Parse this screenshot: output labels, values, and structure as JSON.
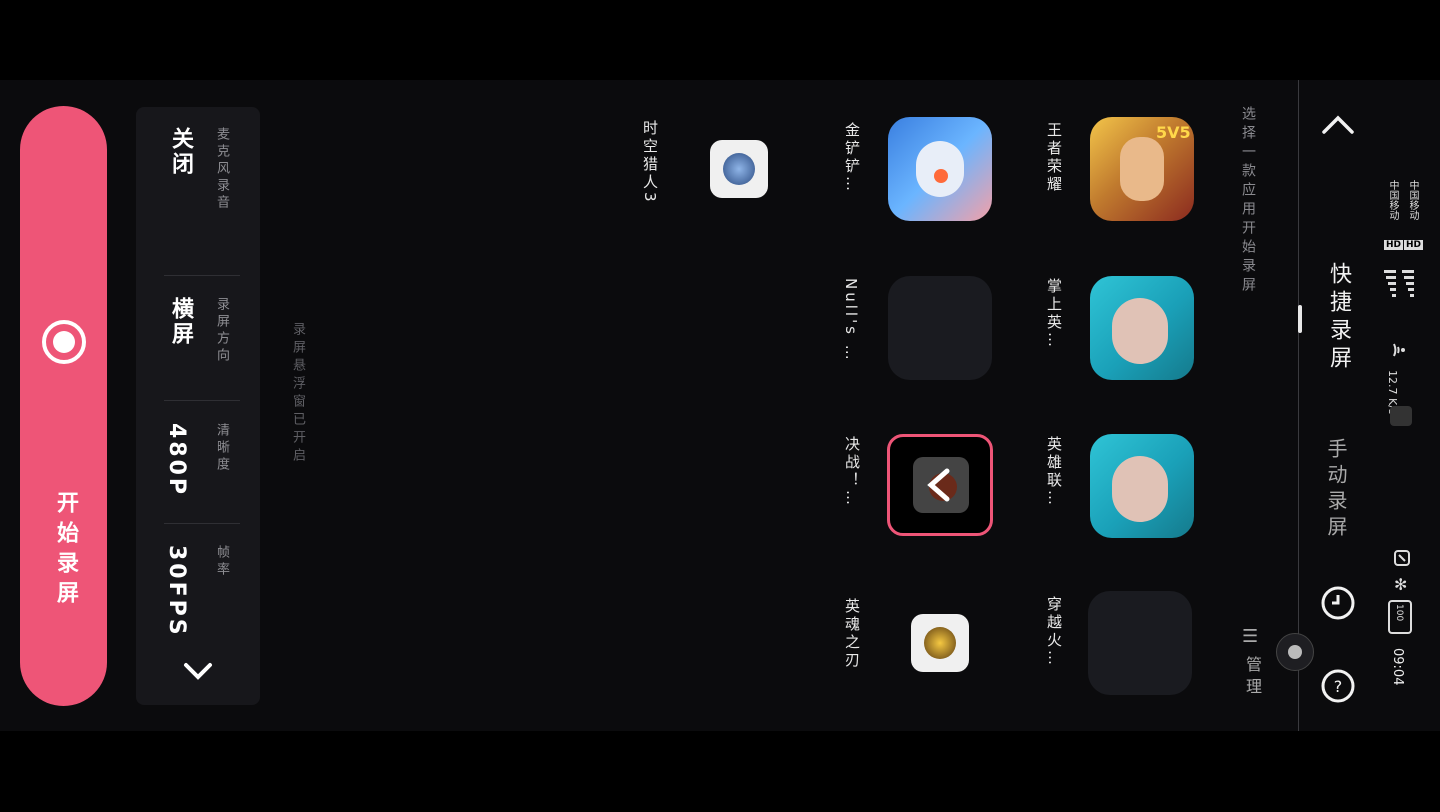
{
  "status": {
    "carrier1": "中国移动",
    "carrier2": "中国移动",
    "net1": "HD",
    "net2": "HD",
    "gen": "4G",
    "speed": "12.7 K/s",
    "battery": "100",
    "time": "09:04"
  },
  "nav": {
    "quick_record": "快捷录屏",
    "manual_record": "手动录屏",
    "manage": "管理"
  },
  "hint": "选择一款应用开始录屏",
  "apps": [
    {
      "label": "王者荣耀"
    },
    {
      "label": "掌上英…"
    },
    {
      "label": "英雄联…"
    },
    {
      "label": "穿越火…"
    },
    {
      "label": "金铲铲…"
    },
    {
      "label": "Null's …"
    },
    {
      "label": "决战！…"
    },
    {
      "label": "英魂之刃"
    },
    {
      "label": "时空猎人3"
    }
  ],
  "float_hint": "录屏悬浮窗已开启",
  "settings": {
    "mic": {
      "name": "麦克风录音",
      "value": "关闭"
    },
    "orientation": {
      "name": "录屏方向",
      "value": "横屏"
    },
    "clarity": {
      "name": "清晰度",
      "value": "480P"
    },
    "fps": {
      "name": "帧率",
      "value": "30FPS"
    }
  },
  "record_button": "开始录屏",
  "colors": {
    "accent": "#ee5577",
    "background": "#0b0b0d",
    "panel": "#17171b"
  }
}
